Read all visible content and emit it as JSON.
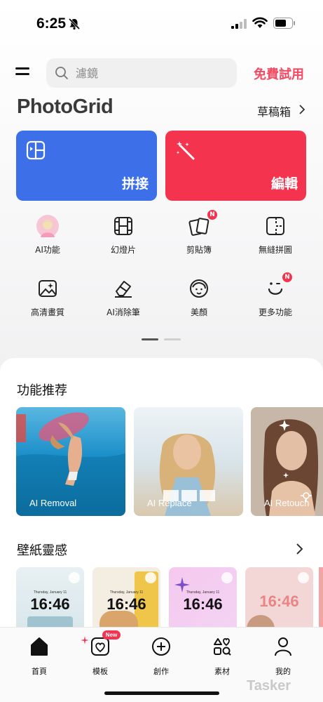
{
  "status_bar": {
    "time": "6:25"
  },
  "header": {
    "search_placeholder": "濾鏡",
    "trial_label": "免費試用",
    "logo": "PhotoGrid",
    "drafts_label": "草稿箱"
  },
  "big_cards": {
    "collage_label": "拼接",
    "edit_label": "編輯"
  },
  "tools": [
    {
      "label": "AI功能"
    },
    {
      "label": "幻燈片"
    },
    {
      "label": "剪貼簿",
      "badge": "N"
    },
    {
      "label": "無縫拼圖"
    },
    {
      "label": "高清畫質"
    },
    {
      "label": "AI消除筆"
    },
    {
      "label": "美顏"
    },
    {
      "label": "更多功能",
      "badge": "N"
    }
  ],
  "features": {
    "title": "功能推荐",
    "cards": [
      {
        "label": "AI Removal"
      },
      {
        "label": "AI Replace"
      },
      {
        "label": "AI Retouch"
      }
    ]
  },
  "wallpapers": {
    "title": "壁紙靈感",
    "cards": [
      {
        "time": "16:46",
        "date": "Thursday, January 11"
      },
      {
        "time": "16:46",
        "date": "Thursday, January 11"
      },
      {
        "time": "16:46",
        "date": "Thursday, January 11"
      },
      {
        "time": "16:46",
        "date": ""
      }
    ]
  },
  "bottom_nav": {
    "items": [
      {
        "label": "首頁"
      },
      {
        "label": "模板",
        "badge": "New"
      },
      {
        "label": "創作"
      },
      {
        "label": "素材"
      },
      {
        "label": "我的"
      }
    ]
  },
  "watermark": "Tasker",
  "colors": {
    "accent_red": "#f4344f",
    "accent_blue": "#3d6fe9",
    "trial_pink": "#f14a62"
  }
}
